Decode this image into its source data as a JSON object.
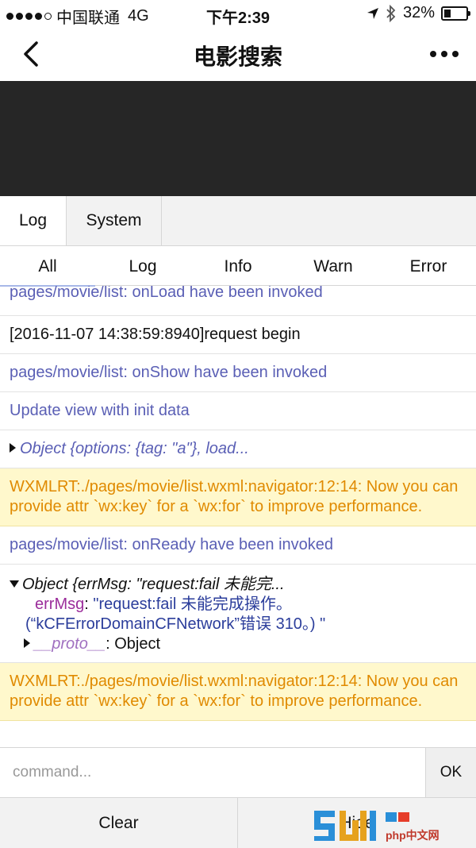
{
  "status_bar": {
    "carrier": "中国联通",
    "network": "4G",
    "time": "下午2:39",
    "battery": "32%",
    "battery_level": 0.32
  },
  "nav": {
    "title": "电影搜索"
  },
  "console": {
    "tabs": [
      "Log",
      "System"
    ],
    "filters": [
      "All",
      "Log",
      "Info",
      "Warn",
      "Error"
    ],
    "active_filter": "All",
    "logs": {
      "l0": "pages/movie/list: onLoad have been invoked",
      "l1": "[2016-11-07 14:38:59:8940]request begin",
      "l2": "pages/movie/list: onShow have been invoked",
      "l3": "Update view with init data",
      "l4": "Object {options: {tag: \"a\"}, load...",
      "l5": "WXMLRT:./pages/movie/list.wxml:navigator:12:14: Now you can provide attr `wx:key` for a `wx:for` to improve performance.",
      "l6": "pages/movie/list: onReady have been invoked",
      "l7_head": "Object {errMsg: \"request:fail 未能完...",
      "l7_key": "errMsg",
      "l7_value_1": "\"request:fail 未能完成操作。",
      "l7_value_2": "(“kCFErrorDomainCFNetwork”错误 310。) \"",
      "l7_proto_key": "__proto__",
      "l7_proto_value": "Object",
      "l8": "WXMLRT:./pages/movie/list.wxml:navigator:12:14: Now you can provide attr `wx:key` for a `wx:for` to improve performance."
    }
  },
  "command": {
    "placeholder": "command...",
    "ok_label": "OK"
  },
  "bottom": {
    "clear_label": "Clear",
    "hide_label": "Hide",
    "watermark_site": "php中文网"
  }
}
